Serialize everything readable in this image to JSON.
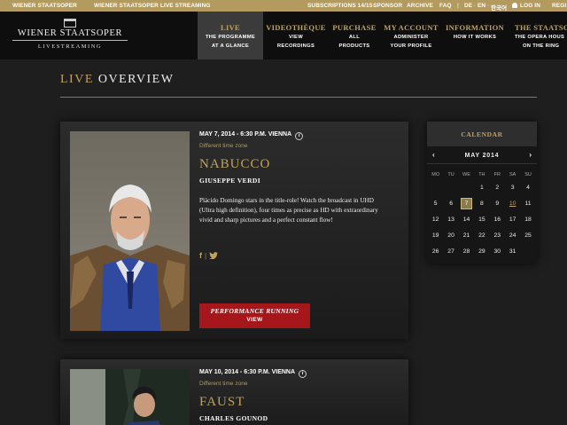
{
  "topbar": {
    "brand": "WIENER STAATSOPER",
    "streaming": "WIENER STAATSOPER LIVE STREAMING",
    "subscriptions": "SUBSCRIPTIONS 14/15",
    "sponsor": "SPONSOR",
    "archive": "ARCHIVE",
    "faq": "FAQ",
    "lang_de": "DE",
    "lang_en": "EN",
    "lang_ko": "한국어",
    "login": "LOG IN",
    "register": "REGI"
  },
  "logo": {
    "name": "WIENER STAATSOPER",
    "sub": "LIVESTREAMING"
  },
  "nav": [
    {
      "title": "LIVE",
      "sub1": "THE PROGRAMME",
      "sub2": "AT A GLANCE"
    },
    {
      "title": "VIDEOTHÈQUE",
      "sub1": "VIEW",
      "sub2": "RECORDINGS"
    },
    {
      "title": "PURCHASE",
      "sub1": "ALL",
      "sub2": "PRODUCTS"
    },
    {
      "title": "MY ACCOUNT",
      "sub1": "ADMINISTER",
      "sub2": "YOUR PROFILE"
    },
    {
      "title": "INFORMATION",
      "sub1": "HOW IT WORKS",
      "sub2": ""
    },
    {
      "title": "THE STAATSOP",
      "sub1": "THE OPERA HOUS",
      "sub2": "ON THE RING"
    }
  ],
  "page_title": {
    "accent": "LIVE",
    "rest": "OVERVIEW"
  },
  "events": [
    {
      "date": "MAY 7, 2014 - 6:30 P.M. VIENNA",
      "timezone": "Different time zone",
      "title": "NABUCCO",
      "composer": "GIUSEPPE VERDI",
      "description": "Plácido Domingo stars in the title-role! Watch the broadcast in UHD (Ultra high definition), four times as precise as HD with extraordinary vivid and sharp pictures and a perfect constant flow!",
      "social_fb": "f",
      "status": "PERFORMANCE RUNNING",
      "action": "VIEW"
    },
    {
      "date": "MAY 10, 2014 - 6:30 P.M. VIENNA",
      "timezone": "Different time zone",
      "title": "FAUST",
      "composer": "CHARLES GOUNOD"
    }
  ],
  "calendar": {
    "heading": "CALENDAR",
    "month": "MAY 2014",
    "prev": "‹",
    "next": "›",
    "weekdays": [
      "MO",
      "TU",
      "WE",
      "TH",
      "FR",
      "SA",
      "SU"
    ],
    "weeks": [
      [
        "",
        "",
        "",
        "1",
        "2",
        "3",
        "4"
      ],
      [
        "5",
        "6",
        "7",
        "8",
        "9",
        "10",
        "11"
      ],
      [
        "12",
        "13",
        "14",
        "15",
        "16",
        "17",
        "18"
      ],
      [
        "19",
        "20",
        "21",
        "22",
        "23",
        "24",
        "25"
      ],
      [
        "26",
        "27",
        "28",
        "29",
        "30",
        "31",
        ""
      ]
    ],
    "selected_day": "7",
    "linked_days": [
      "10"
    ]
  },
  "colors": {
    "gold": "#c2a25c",
    "topbar": "#b39a5e",
    "header": "#0e0e0e",
    "background": "#1e1e1e",
    "running_red": "#a6171b"
  }
}
